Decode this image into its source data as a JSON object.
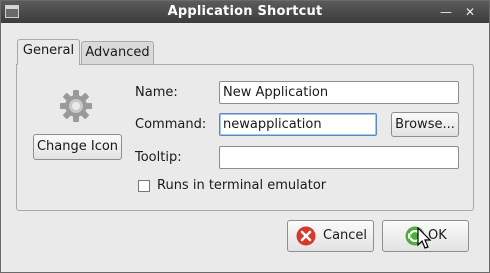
{
  "window": {
    "title": "Application Shortcut"
  },
  "tabs": [
    {
      "label": "General",
      "active": true
    },
    {
      "label": "Advanced",
      "active": false
    }
  ],
  "general": {
    "icon_name": "gear-icon",
    "change_icon_label": "Change Icon",
    "name_label": "Name:",
    "name_value": "New Application",
    "command_label": "Command:",
    "command_value": "newapplication",
    "browse_label": "Browse...",
    "tooltip_label": "Tooltip:",
    "tooltip_value": "",
    "terminal_label": "Runs in terminal emulator",
    "terminal_checked": false
  },
  "buttons": {
    "cancel_label": "Cancel",
    "ok_label": "OK"
  },
  "colors": {
    "titlebar": "#3c3c3c",
    "cancel_icon": "#d8372e",
    "ok_icon": "#4caf3a"
  }
}
